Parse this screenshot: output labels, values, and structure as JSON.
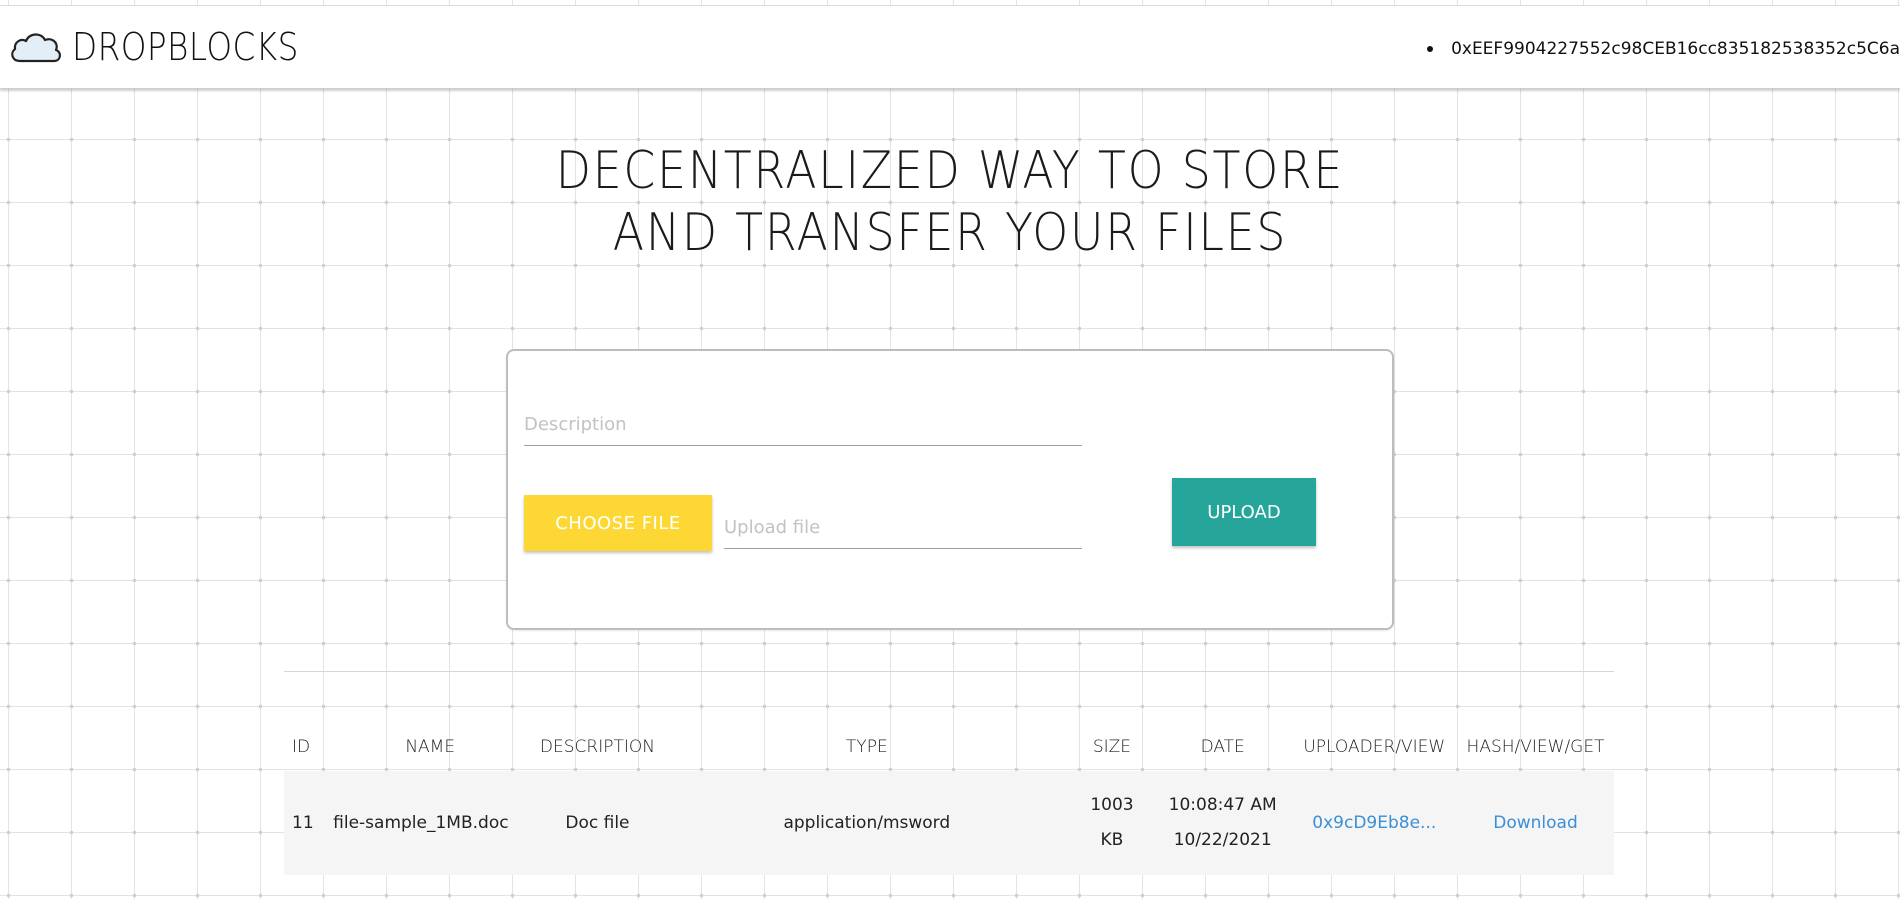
{
  "header": {
    "brand_name": "DROPBLOCKS",
    "brand_icon": "cloud-icon",
    "account_address": "0xEEF9904227552c98CEB16cc835182538352c5C6a"
  },
  "hero": {
    "title_line1": "DECENTRALIZED WAY TO STORE",
    "title_line2": "AND TRANSFER YOUR FILES"
  },
  "upload_form": {
    "description_placeholder": "Description",
    "description_value": "",
    "choose_file_label": "CHOOSE FILE",
    "file_placeholder": "Upload file",
    "upload_label": "UPLOAD",
    "colors": {
      "choose_file": "#fdd835",
      "upload": "#26a69a"
    }
  },
  "files_table": {
    "columns": [
      "ID",
      "NAME",
      "DESCRIPTION",
      "TYPE",
      "SIZE",
      "DATE",
      "UPLOADER/VIEW",
      "HASH/VIEW/GET"
    ],
    "rows": [
      {
        "id": "11",
        "name": "file-sample_1MB.doc",
        "description": "Doc file",
        "type": "application/msword",
        "size_value": "1003",
        "size_unit": "KB",
        "time": "10:08:47 AM",
        "date": "10/22/2021",
        "uploader": "0x9cD9Eb8e...",
        "hash_action": "Download"
      }
    ],
    "link_color": "#3a8fd6"
  }
}
